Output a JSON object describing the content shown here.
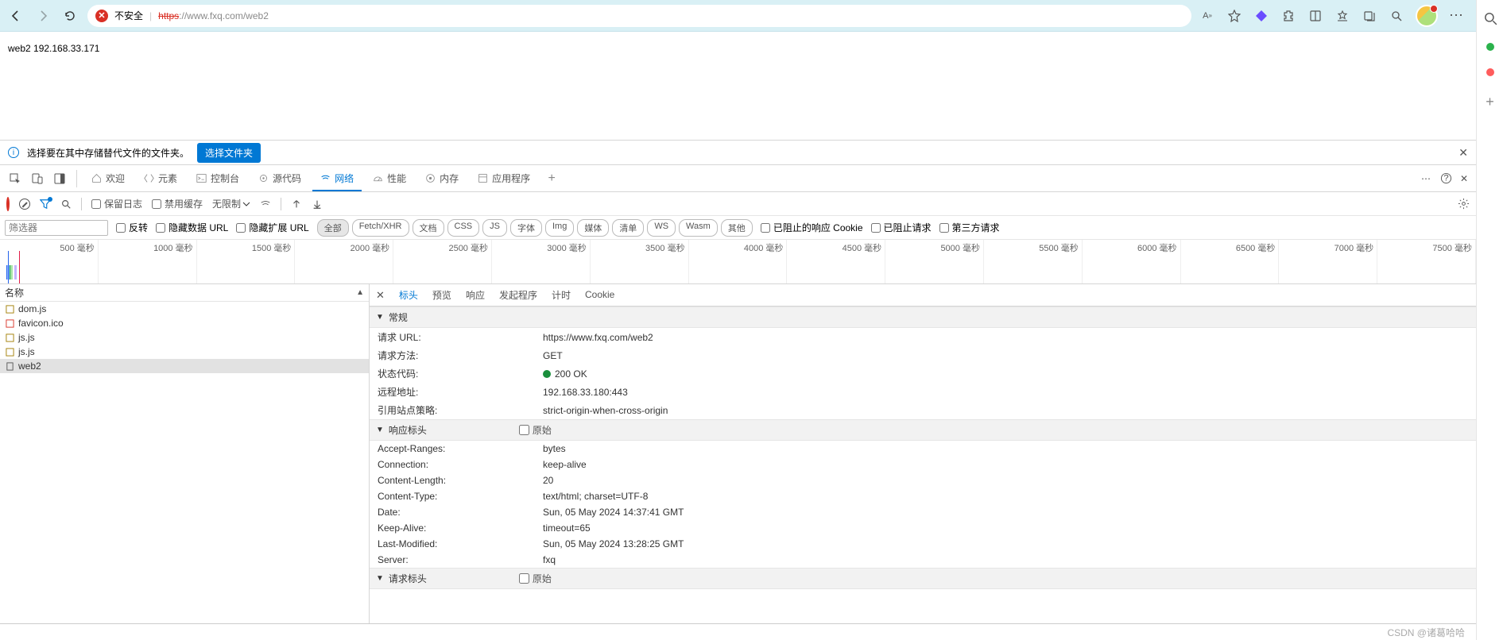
{
  "address_bar": {
    "not_secure_label": "不安全",
    "url_protocol": "https",
    "url_rest": "://www.fxq.com/web2",
    "aa_label": "A"
  },
  "page": {
    "body_text": "web2 192.168.33.171"
  },
  "info_bar": {
    "message": "选择要在其中存储替代文件的文件夹。",
    "button": "选择文件夹"
  },
  "devtools_tabs": {
    "welcome": "欢迎",
    "elements": "元素",
    "console": "控制台",
    "sources": "源代码",
    "network": "网络",
    "performance": "性能",
    "memory": "内存",
    "application": "应用程序"
  },
  "net_toolbar": {
    "preserve_log": "保留日志",
    "disable_cache": "禁用缓存",
    "throttle": "无限制"
  },
  "filter_row": {
    "placeholder": "筛选器",
    "invert": "反转",
    "hide_data_urls": "隐藏数据 URL",
    "hide_ext_urls": "隐藏扩展 URL",
    "types": [
      "全部",
      "Fetch/XHR",
      "文档",
      "CSS",
      "JS",
      "字体",
      "Img",
      "媒体",
      "清单",
      "WS",
      "Wasm",
      "其他"
    ],
    "blocked_cookies": "已阻止的响应 Cookie",
    "blocked_req": "已阻止请求",
    "third_party": "第三方请求"
  },
  "timeline_ticks": [
    "500 毫秒",
    "1000 毫秒",
    "1500 毫秒",
    "2000 毫秒",
    "2500 毫秒",
    "3000 毫秒",
    "3500 毫秒",
    "4000 毫秒",
    "4500 毫秒",
    "5000 毫秒",
    "5500 毫秒",
    "6000 毫秒",
    "6500 毫秒",
    "7000 毫秒",
    "7500 毫秒"
  ],
  "requests": {
    "header": "名称",
    "rows": [
      {
        "icon": "js",
        "name": "dom.js"
      },
      {
        "icon": "red",
        "name": "favicon.ico"
      },
      {
        "icon": "js",
        "name": "js.js"
      },
      {
        "icon": "js",
        "name": "js.js"
      },
      {
        "icon": "doc",
        "name": "web2"
      }
    ]
  },
  "detail_tabs": {
    "headers": "标头",
    "preview": "预览",
    "response": "响应",
    "initiator": "发起程序",
    "timing": "计时",
    "cookies": "Cookie"
  },
  "detail": {
    "general_title": "常规",
    "general": [
      {
        "k": "请求 URL:",
        "v": "https://www.fxq.com/web2"
      },
      {
        "k": "请求方法:",
        "v": "GET"
      },
      {
        "k": "状态代码:",
        "v": "200 OK",
        "status": true
      },
      {
        "k": "远程地址:",
        "v": "192.168.33.180:443"
      },
      {
        "k": "引用站点策略:",
        "v": "strict-origin-when-cross-origin"
      }
    ],
    "resp_title": "响应标头",
    "raw_label": "原始",
    "resp": [
      {
        "k": "Accept-Ranges:",
        "v": "bytes"
      },
      {
        "k": "Connection:",
        "v": "keep-alive"
      },
      {
        "k": "Content-Length:",
        "v": "20"
      },
      {
        "k": "Content-Type:",
        "v": "text/html; charset=UTF-8"
      },
      {
        "k": "Date:",
        "v": "Sun, 05 May 2024 14:37:41 GMT"
      },
      {
        "k": "Keep-Alive:",
        "v": "timeout=65"
      },
      {
        "k": "Last-Modified:",
        "v": "Sun, 05 May 2024 13:28:25 GMT"
      },
      {
        "k": "Server:",
        "v": "fxq"
      }
    ],
    "req_title": "请求标头"
  },
  "footer": {
    "watermark": "CSDN @诸葛哈哈"
  }
}
